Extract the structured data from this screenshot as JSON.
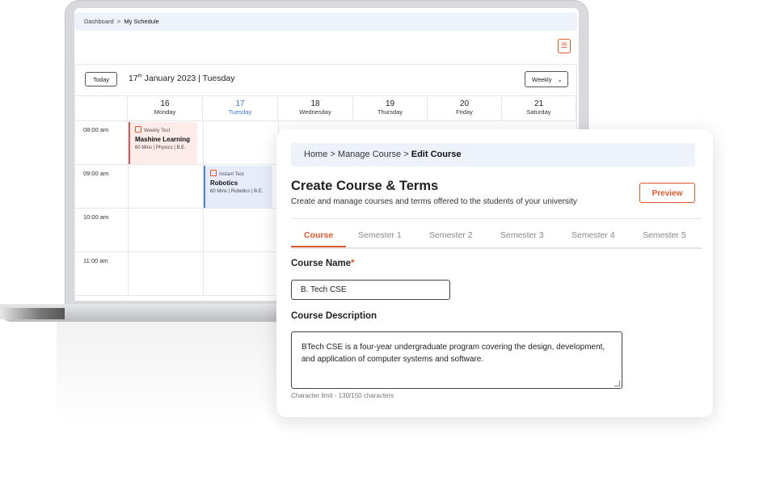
{
  "calendar": {
    "breadcrumb": {
      "root": "Dashboard",
      "sep": ">",
      "current": "My Schedule"
    },
    "today_label": "Today",
    "date_day": "17",
    "date_sup": "th",
    "date_rest": " January 2023 | Tuesday",
    "view_select": "Weekly",
    "days": [
      {
        "num": "16",
        "name": "Monday"
      },
      {
        "num": "17",
        "name": "Tuesday"
      },
      {
        "num": "18",
        "name": "Wednesday"
      },
      {
        "num": "19",
        "name": "Thursday"
      },
      {
        "num": "20",
        "name": "Friday"
      },
      {
        "num": "21",
        "name": "Saturday"
      }
    ],
    "times": [
      "08:00 am",
      "09:00 am",
      "10:00 am",
      "11:00 am"
    ],
    "events": [
      {
        "type": "Weekly Test",
        "title": "Mashine Learning",
        "meta": "60 Mins | Physics | B.E.",
        "color": "#e05555"
      },
      {
        "type": "Instant Test",
        "title": "Robotics",
        "meta": "60 Mins | Robotics | B.E.",
        "color": "#4a7fe0"
      }
    ]
  },
  "course": {
    "breadcrumb": {
      "home": "Home",
      "sep1": ">",
      "manage": "Manage Course",
      "sep2": ">",
      "current": "Edit Course"
    },
    "title": "Create Course & Terms",
    "subtitle": "Create and manage courses and terms offered to the students of your university",
    "preview_label": "Preview",
    "tabs": [
      "Course",
      "Semester 1",
      "Semester 2",
      "Semester 3",
      "Semester 4",
      "Semester 5"
    ],
    "name_label": "Course Name",
    "required_mark": "*",
    "name_value": "B. Tech CSE",
    "desc_label": "Course Description",
    "desc_value": "BTech CSE is a four-year undergraduate program covering the design, development, and application of computer systems and software.",
    "char_limit": "Character limit - 130/150 characters"
  },
  "colors": {
    "accent": "#e0592a",
    "active_day": "#3a7bd5"
  }
}
